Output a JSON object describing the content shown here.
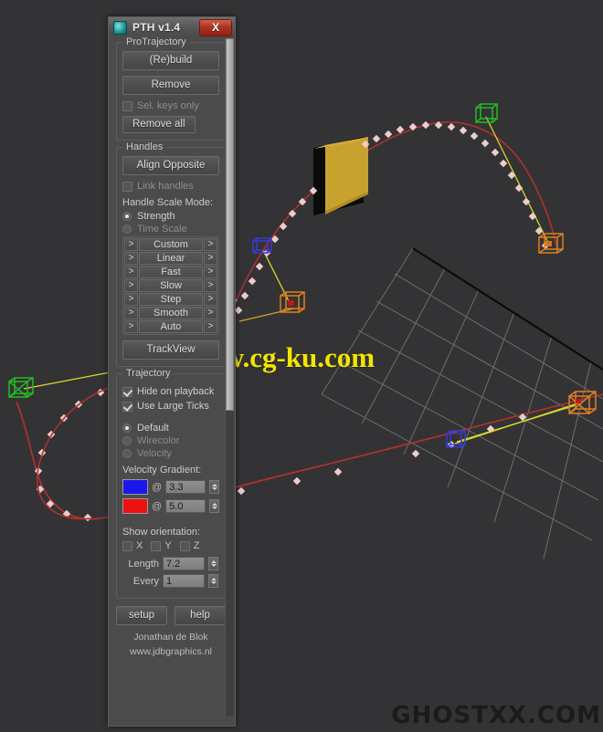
{
  "window": {
    "title": "PTH v1.4",
    "app_icon": "sphere-icon",
    "close_label": "X"
  },
  "protrajectory": {
    "group_label": "ProTrajectory",
    "rebuild_label": "(Re)build",
    "remove_label": "Remove",
    "sel_keys_only_label": "Sel. keys only",
    "sel_keys_only_checked": false,
    "remove_all_label": "Remove all"
  },
  "handles": {
    "group_label": "Handles",
    "align_opposite_label": "Align Opposite",
    "link_handles_label": "Link handles",
    "link_handles_checked": false,
    "scale_mode_label": "Handle Scale Mode:",
    "scale_modes": [
      {
        "label": "Strength",
        "selected": true
      },
      {
        "label": "Time Scale",
        "selected": false
      }
    ],
    "presets": [
      "Custom",
      "Linear",
      "Fast",
      "Slow",
      "Step",
      "Smooth",
      "Auto"
    ],
    "arrow_glyph": ">",
    "trackview_label": "TrackView"
  },
  "trajectory": {
    "group_label": "Trajectory",
    "checkboxes": [
      {
        "label": "Hide on playback",
        "checked": true
      },
      {
        "label": "Use Large Ticks",
        "checked": true
      }
    ],
    "color_modes": [
      {
        "label": "Default",
        "selected": true
      },
      {
        "label": "Wirecolor",
        "selected": false
      },
      {
        "label": "Velocity",
        "selected": false
      }
    ],
    "velocity_gradient_label": "Velocity Gradient:",
    "gradient_stops": [
      {
        "color": "#1a18e8",
        "at_symbol": "@",
        "value": "3.3"
      },
      {
        "color": "#ee1111",
        "at_symbol": "@",
        "value": "5.0"
      }
    ],
    "show_orientation_label": "Show orientation:",
    "axes": [
      {
        "label": "X",
        "checked": false
      },
      {
        "label": "Y",
        "checked": false
      },
      {
        "label": "Z",
        "checked": false
      }
    ],
    "length_label": "Length",
    "length_value": "7.2",
    "every_label": "Every",
    "every_value": "1"
  },
  "footer": {
    "setup_label": "setup",
    "help_label": "help",
    "author": "Jonathan de Blok",
    "website": "www.jdbgraphics.nl"
  },
  "viewport": {
    "background": "#333335",
    "watermark_center": "www.cg-ku.com",
    "watermark_center_color": "#f2e600",
    "watermark_bottom": "GHOSTXX.COM",
    "watermark_bottom_color": "#1b1b1b",
    "objects": {
      "box_color": "#c8a22e",
      "trajectory_color": "#b03030",
      "tick_color": "#e7c9c9",
      "handle_line_color": "#d8d82a",
      "handle_orange": "#e08020",
      "handle_blue": "#3a3ad0",
      "handle_green": "#22c422",
      "grid_color": "#9b9b9b"
    }
  }
}
